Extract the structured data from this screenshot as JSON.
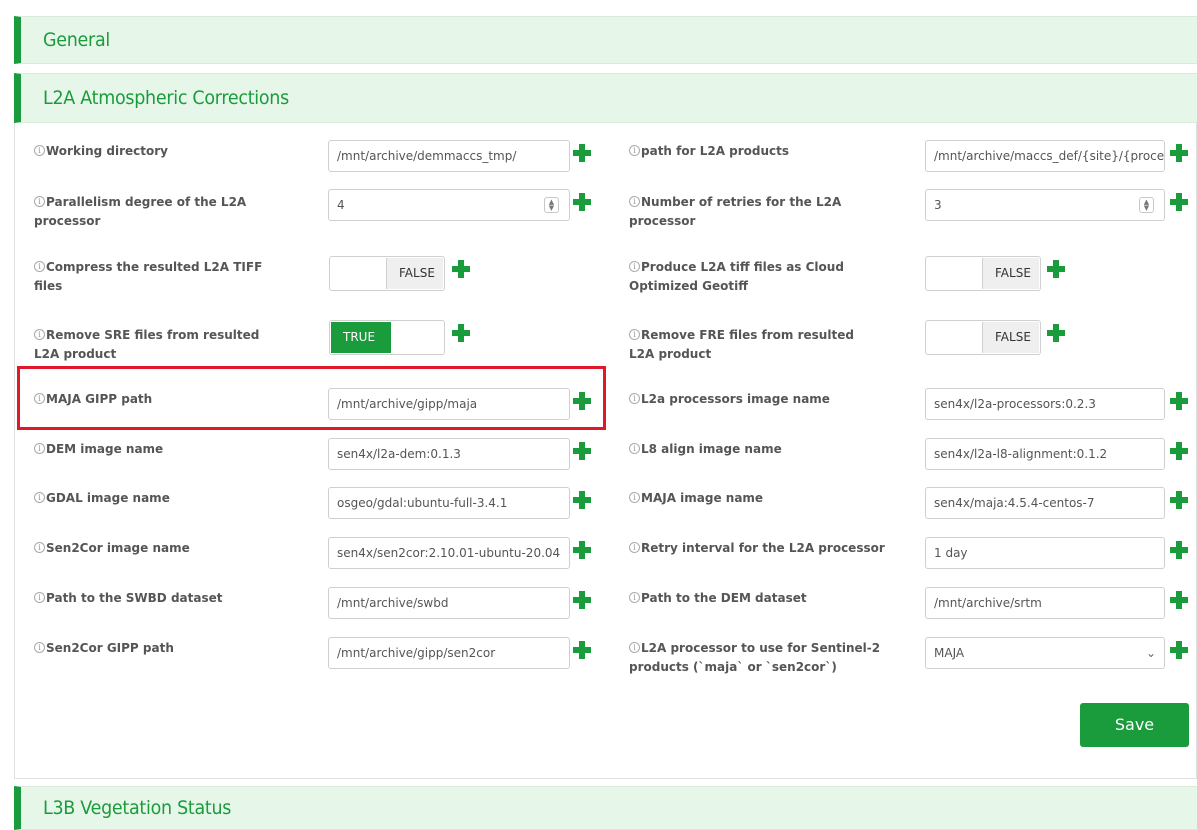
{
  "sections": {
    "general": "General",
    "l2a": "L2A Atmospheric Corrections",
    "l3b": "L3B Vegetation Status"
  },
  "info_icon": "info-circle-icon",
  "fields": {
    "working_directory": {
      "label": "Working directory",
      "value": "/mnt/archive/demmaccs_tmp/"
    },
    "path_l2a_products": {
      "label": "path for L2A products",
      "value": "/mnt/archive/maccs_def/{site}/{processor}"
    },
    "parallelism_degree": {
      "label": "Parallelism degree of the L2A processor",
      "value": "4"
    },
    "number_of_retries": {
      "label": "Number of retries for the L2A processor",
      "value": "3"
    },
    "compress_tiff": {
      "label": "Compress the resulted L2A TIFF files",
      "value": "FALSE"
    },
    "cloud_optimized": {
      "label": "Produce L2A tiff files as Cloud Optimized Geotiff",
      "value": "FALSE"
    },
    "remove_sre": {
      "label": "Remove SRE files from resulted L2A product",
      "value": "TRUE"
    },
    "remove_fre": {
      "label": "Remove FRE files from resulted L2A product",
      "value": "FALSE"
    },
    "maja_gipp_path": {
      "label": "MAJA GIPP path",
      "value": "/mnt/archive/gipp/maja"
    },
    "l2a_processors_image": {
      "label": "L2a processors image name",
      "value": "sen4x/l2a-processors:0.2.3"
    },
    "dem_image": {
      "label": "DEM image name",
      "value": "sen4x/l2a-dem:0.1.3"
    },
    "l8_align_image": {
      "label": "L8 align image name",
      "value": "sen4x/l2a-l8-alignment:0.1.2"
    },
    "gdal_image": {
      "label": "GDAL image name",
      "value": "osgeo/gdal:ubuntu-full-3.4.1"
    },
    "maja_image": {
      "label": "MAJA image name",
      "value": "sen4x/maja:4.5.4-centos-7"
    },
    "sen2cor_image": {
      "label": "Sen2Cor image name",
      "value": "sen4x/sen2cor:2.10.01-ubuntu-20.04"
    },
    "retry_interval": {
      "label": "Retry interval for the L2A processor",
      "value": "1 day"
    },
    "swbd_path": {
      "label": "Path to the SWBD dataset",
      "value": "/mnt/archive/swbd"
    },
    "dem_dataset_path": {
      "label": "Path to the DEM dataset",
      "value": "/mnt/archive/srtm"
    },
    "sen2cor_gipp_path": {
      "label": "Sen2Cor GIPP path",
      "value": "/mnt/archive/gipp/sen2cor"
    },
    "l2a_processor_select": {
      "label": "L2A processor to use for Sentinel-2 products (`maja` or `sen2cor`)",
      "value": "MAJA"
    }
  },
  "save_label": "Save",
  "colors": {
    "accent": "#1a9b3c",
    "header_bg": "#e6f6e9",
    "highlight": "#e0192a"
  }
}
